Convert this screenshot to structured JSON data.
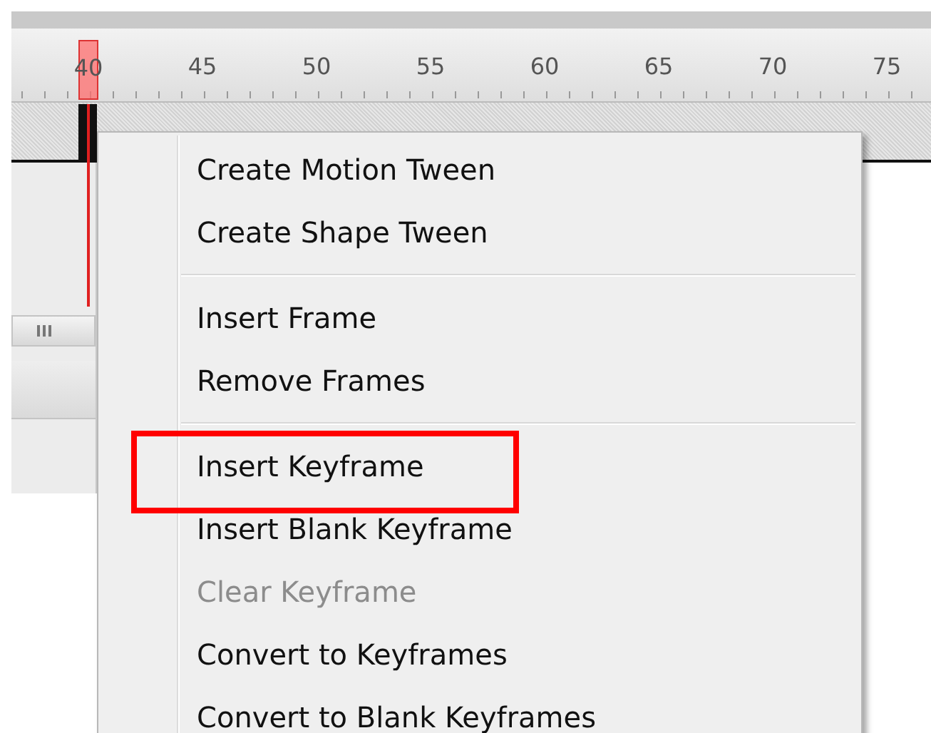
{
  "ruler": {
    "labels": [
      {
        "text": "40",
        "current": true
      },
      {
        "text": "45",
        "current": false
      },
      {
        "text": "50",
        "current": false
      },
      {
        "text": "55",
        "current": false
      },
      {
        "text": "60",
        "current": false
      },
      {
        "text": "65",
        "current": false
      },
      {
        "text": "70",
        "current": false
      },
      {
        "text": "75",
        "current": false
      }
    ]
  },
  "context_menu": {
    "items": [
      {
        "kind": "item",
        "label": "Create Motion Tween",
        "disabled": false,
        "annotated": false
      },
      {
        "kind": "item",
        "label": "Create Shape Tween",
        "disabled": false,
        "annotated": false
      },
      {
        "kind": "separator"
      },
      {
        "kind": "item",
        "label": "Insert Frame",
        "disabled": false,
        "annotated": false
      },
      {
        "kind": "item",
        "label": "Remove Frames",
        "disabled": false,
        "annotated": false
      },
      {
        "kind": "separator"
      },
      {
        "kind": "item",
        "label": "Insert Keyframe",
        "disabled": false,
        "annotated": true
      },
      {
        "kind": "item",
        "label": "Insert Blank Keyframe",
        "disabled": false,
        "annotated": false
      },
      {
        "kind": "item",
        "label": "Clear Keyframe",
        "disabled": true,
        "annotated": false
      },
      {
        "kind": "item",
        "label": "Convert to Keyframes",
        "disabled": false,
        "annotated": false
      },
      {
        "kind": "item",
        "label": "Convert to Blank Keyframes",
        "disabled": false,
        "annotated": false
      }
    ]
  }
}
